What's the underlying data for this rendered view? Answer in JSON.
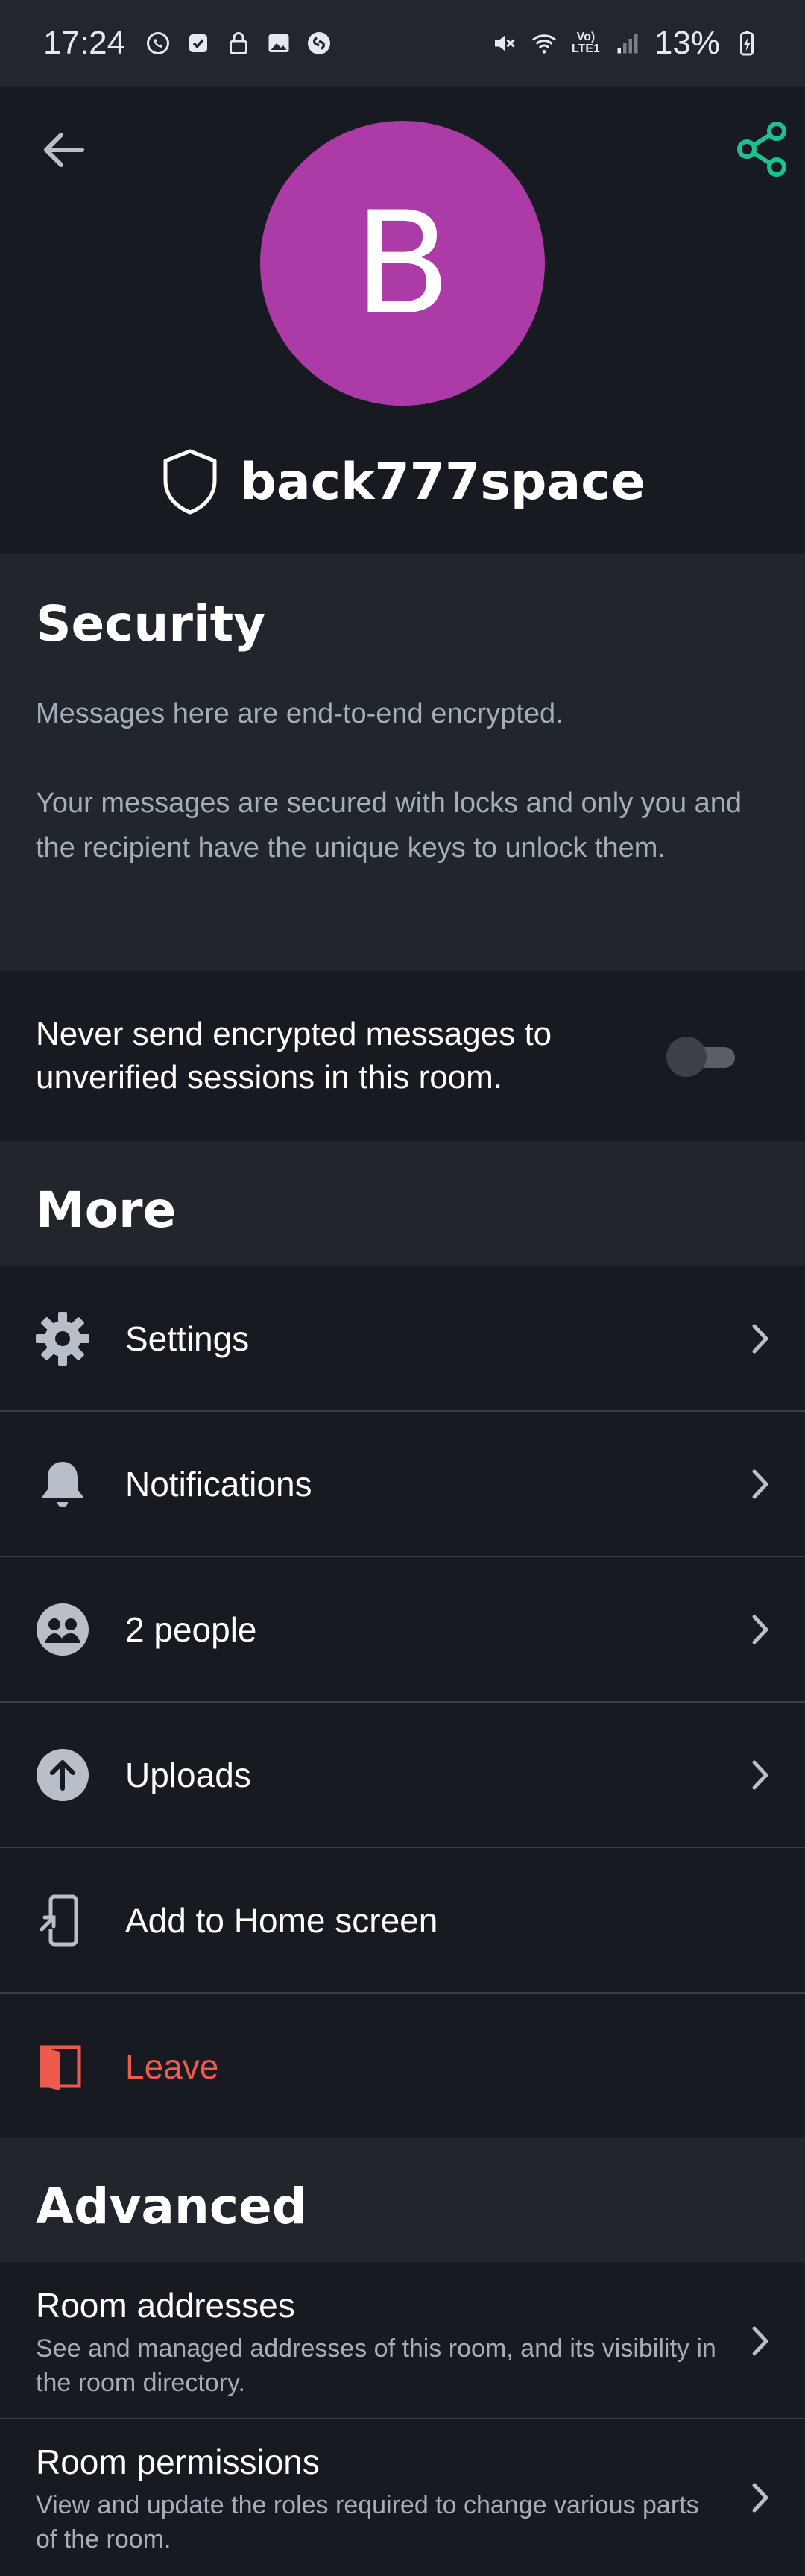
{
  "status_bar": {
    "time": "17:24",
    "battery": "13%",
    "icons": [
      "whatsapp-icon",
      "check-square-icon",
      "lock-icon",
      "gallery-icon",
      "shazam-icon",
      "mute-icon",
      "wifi-icon",
      "volte-icon",
      "signal-icon",
      "battery-charging-icon"
    ],
    "volte": "Vo)\nLTE1"
  },
  "header": {
    "avatar_letter": "B",
    "avatar_color": "#ac3ba8",
    "room_name": "back777space",
    "accent": "#1fc090"
  },
  "security": {
    "title": "Security",
    "line1": "Messages here are end-to-end encrypted.",
    "line2": "Your messages are secured with locks and only you and the recipient have the unique keys to unlock them.",
    "toggle_label": "Never send encrypted messages to unverified sessions in this room.",
    "toggle_on": false
  },
  "more": {
    "title": "More",
    "items": [
      {
        "label": "Settings",
        "icon": "gear-icon"
      },
      {
        "label": "Notifications",
        "icon": "bell-icon"
      },
      {
        "label": "2 people",
        "icon": "people-icon"
      },
      {
        "label": "Uploads",
        "icon": "upload-icon"
      },
      {
        "label": "Add to Home screen",
        "icon": "add-to-home-icon"
      },
      {
        "label": "Leave",
        "icon": "leave-door-icon",
        "danger_color": "#ef5a4f"
      }
    ]
  },
  "advanced": {
    "title": "Advanced",
    "items": [
      {
        "title": "Room addresses",
        "description": "See and managed addresses of this room, and its visibility in the room directory."
      },
      {
        "title": "Room permissions",
        "description": "View and update the roles required to change various parts of the room."
      }
    ]
  }
}
